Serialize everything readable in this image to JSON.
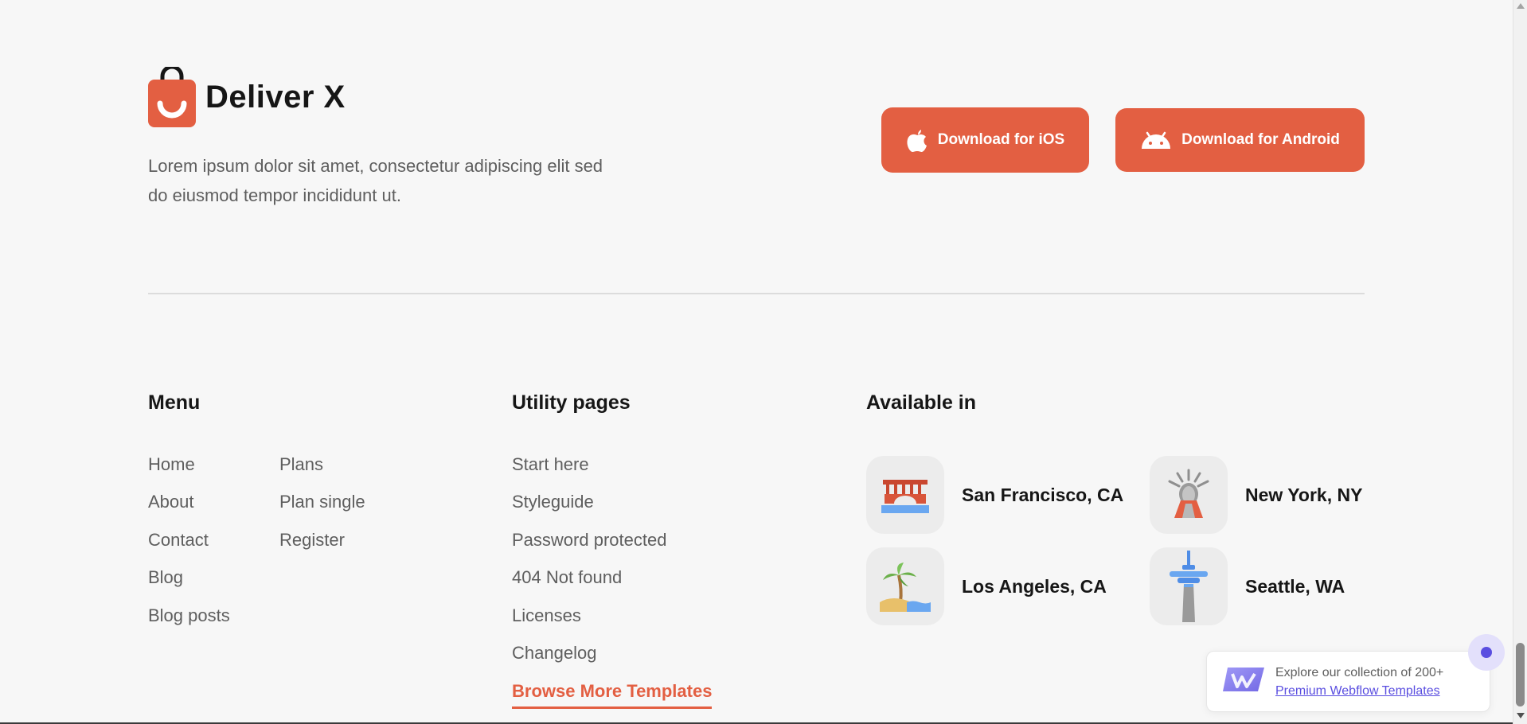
{
  "brand": {
    "name": "Deliver X",
    "description": "Lorem ipsum dolor sit amet, consectetur adipiscing elit sed do eiusmod tempor incididunt ut.",
    "logo_icon": "shopping-bag-smile-icon"
  },
  "downloads": {
    "ios_label": "Download for iOS",
    "android_label": "Download for Android",
    "ios_icon": "apple-icon",
    "android_icon": "android-icon"
  },
  "menu": {
    "title": "Menu",
    "col1": [
      "Home",
      "About",
      "Contact",
      "Blog",
      "Blog posts"
    ],
    "col2": [
      "Plans",
      "Plan single",
      "Register"
    ]
  },
  "utility": {
    "title": "Utility pages",
    "links": [
      "Start here",
      "Styleguide",
      "Password protected",
      "404 Not found",
      "Licenses",
      "Changelog"
    ],
    "browse": "Browse More Templates"
  },
  "available": {
    "title": "Available in",
    "cities": [
      {
        "name": "San Francisco, CA",
        "icon": "golden-gate-bridge-icon"
      },
      {
        "name": "New York, NY",
        "icon": "statue-of-liberty-icon"
      },
      {
        "name": "Los Angeles, CA",
        "icon": "palm-beach-icon"
      },
      {
        "name": "Seattle, WA",
        "icon": "space-needle-icon"
      }
    ]
  },
  "promo": {
    "text": "Explore our collection of 200+",
    "link": "Premium Webflow Templates",
    "icon": "webflow-logo-icon"
  },
  "colors": {
    "accent": "#e35f42",
    "promo_accent": "#5a4ee0",
    "background": "#f7f7f7"
  }
}
